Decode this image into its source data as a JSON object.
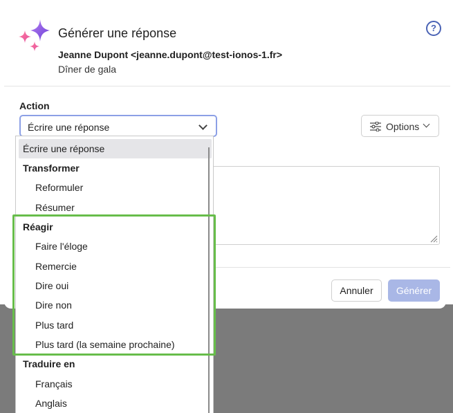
{
  "header": {
    "title": "Générer une réponse",
    "sender": "Jeanne Dupont <jeanne.dupont@test-ionos-1.fr>",
    "subject": "Dîner de gala",
    "help_glyph": "?"
  },
  "action": {
    "label": "Action",
    "selected": "Écrire une réponse"
  },
  "options_button": {
    "label": "Options"
  },
  "dropdown": {
    "items": [
      {
        "label": "Écrire une réponse",
        "kind": "option",
        "selected": true
      },
      {
        "label": "Transformer",
        "kind": "group"
      },
      {
        "label": "Reformuler",
        "kind": "option"
      },
      {
        "label": "Résumer",
        "kind": "option"
      },
      {
        "label": "Réagir",
        "kind": "group"
      },
      {
        "label": "Faire l'éloge",
        "kind": "option"
      },
      {
        "label": "Remercie",
        "kind": "option"
      },
      {
        "label": "Dire oui",
        "kind": "option"
      },
      {
        "label": "Dire non",
        "kind": "option"
      },
      {
        "label": "Plus tard",
        "kind": "option"
      },
      {
        "label": "Plus tard (la semaine prochaine)",
        "kind": "option"
      },
      {
        "label": "Traduire en",
        "kind": "group"
      },
      {
        "label": "Français",
        "kind": "option"
      },
      {
        "label": "Anglais",
        "kind": "option"
      }
    ]
  },
  "footer": {
    "cancel_label": "Annuler",
    "generate_label": "Générer"
  },
  "colors": {
    "accent": "#4a63b5",
    "highlight_frame": "#67bd4a",
    "generate_disabled": "#a9b7e6"
  }
}
